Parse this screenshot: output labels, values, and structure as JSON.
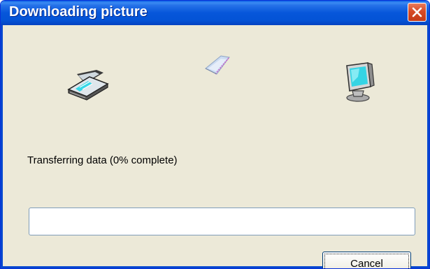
{
  "window": {
    "title": "Downloading picture",
    "close_label": "Close"
  },
  "icons": {
    "source": "scanner-icon",
    "transfer": "flying-picture-icon",
    "destination": "computer-icon"
  },
  "status": {
    "text": "Transferring data (0% complete)",
    "progress_fraction": 0
  },
  "buttons": {
    "cancel_label": "Cancel"
  },
  "colors": {
    "titlebar": "#0656da",
    "dialog_background": "#ece9d8",
    "close_button": "#d64b26"
  }
}
